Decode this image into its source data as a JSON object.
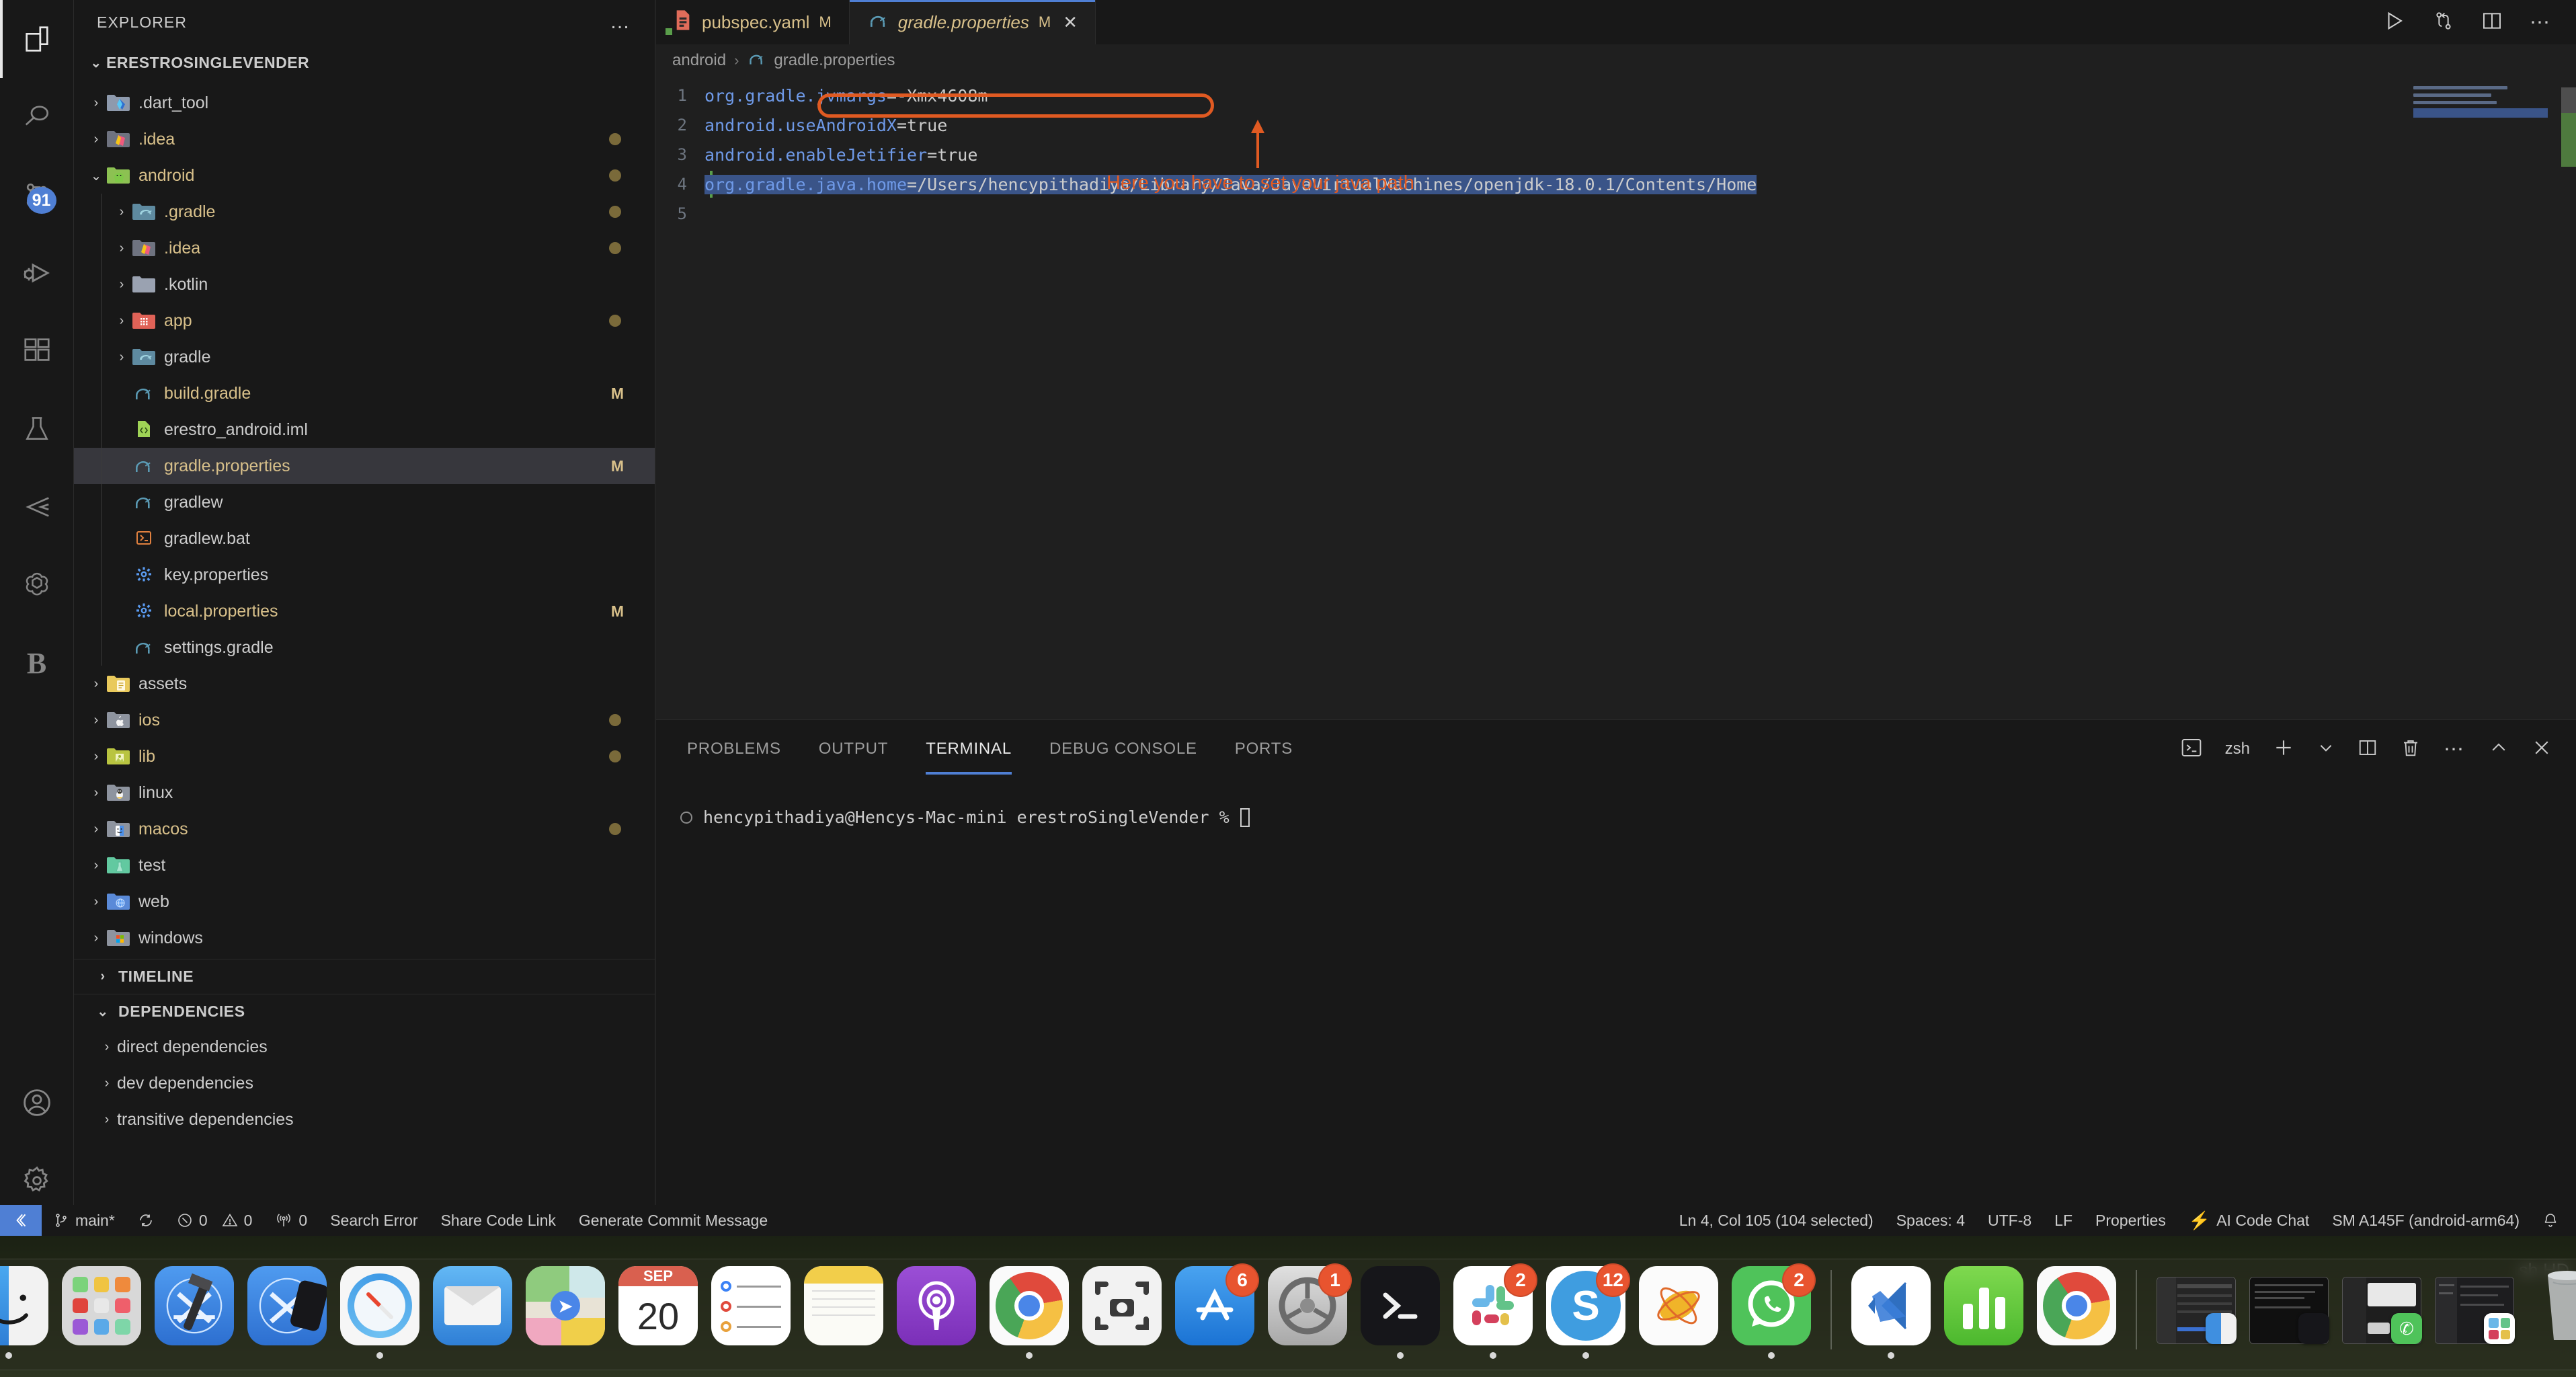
{
  "activity_bar": {
    "items": [
      {
        "name": "explorer",
        "icon": "files-icon",
        "active": true,
        "badge": null
      },
      {
        "name": "search",
        "icon": "search-icon",
        "active": false,
        "badge": null
      },
      {
        "name": "source-control",
        "icon": "source-control-icon",
        "active": false,
        "badge": "91"
      },
      {
        "name": "run-and-debug",
        "icon": "run-debug-icon",
        "active": false,
        "badge": null
      },
      {
        "name": "extensions",
        "icon": "extensions-icon",
        "active": false,
        "badge": null
      },
      {
        "name": "testing",
        "icon": "beaker-icon",
        "active": false,
        "badge": null
      },
      {
        "name": "flutter",
        "icon": "flutter-icon",
        "active": false,
        "badge": null
      },
      {
        "name": "openai",
        "icon": "openai-icon",
        "active": false,
        "badge": null
      },
      {
        "name": "blackbox",
        "icon": "letter-b-icon",
        "active": false,
        "badge": null
      }
    ],
    "bottom_items": [
      {
        "name": "accounts",
        "icon": "account-icon"
      },
      {
        "name": "settings",
        "icon": "gear-icon"
      }
    ]
  },
  "sidebar": {
    "title": "EXPLORER",
    "more_actions": "…",
    "root": "ERESTROSINGLEVENDER",
    "tree": [
      {
        "label": ".dart_tool",
        "type": "folder",
        "depth": 1,
        "expanded": false,
        "icon": "dart-folder-icon",
        "status": "",
        "dot": false
      },
      {
        "label": ".idea",
        "type": "folder",
        "depth": 1,
        "expanded": false,
        "icon": "idea-folder-icon",
        "status": "",
        "dot": true,
        "modified": true
      },
      {
        "label": "android",
        "type": "folder",
        "depth": 1,
        "expanded": true,
        "icon": "android-folder-icon",
        "status": "",
        "dot": true,
        "modified": true
      },
      {
        "label": ".gradle",
        "type": "folder",
        "depth": 2,
        "expanded": false,
        "icon": "gradle-folder-icon",
        "status": "",
        "dot": true,
        "modified": true
      },
      {
        "label": ".idea",
        "type": "folder",
        "depth": 2,
        "expanded": false,
        "icon": "idea-folder-icon",
        "status": "",
        "dot": true,
        "modified": true
      },
      {
        "label": ".kotlin",
        "type": "folder",
        "depth": 2,
        "expanded": false,
        "icon": "plain-folder-icon",
        "status": "",
        "dot": false
      },
      {
        "label": "app",
        "type": "folder",
        "depth": 2,
        "expanded": false,
        "icon": "app-folder-icon",
        "status": "",
        "dot": true,
        "modified": true
      },
      {
        "label": "gradle",
        "type": "folder",
        "depth": 2,
        "expanded": false,
        "icon": "gradle-folder-icon",
        "status": "",
        "dot": false
      },
      {
        "label": "build.gradle",
        "type": "file",
        "depth": 2,
        "icon": "gradle-file-icon",
        "status": "M",
        "modified": true
      },
      {
        "label": "erestro_android.iml",
        "type": "file",
        "depth": 2,
        "icon": "iml-file-icon",
        "status": "",
        "modified": false
      },
      {
        "label": "gradle.properties",
        "type": "file",
        "depth": 2,
        "icon": "gradle-file-icon",
        "status": "M",
        "modified": true,
        "selected": true
      },
      {
        "label": "gradlew",
        "type": "file",
        "depth": 2,
        "icon": "gradle-file-icon",
        "status": "",
        "modified": false
      },
      {
        "label": "gradlew.bat",
        "type": "file",
        "depth": 2,
        "icon": "bat-file-icon",
        "status": "",
        "modified": false
      },
      {
        "label": "key.properties",
        "type": "file",
        "depth": 2,
        "icon": "properties-file-icon",
        "status": "",
        "modified": false
      },
      {
        "label": "local.properties",
        "type": "file",
        "depth": 2,
        "icon": "properties-file-icon",
        "status": "M",
        "modified": true
      },
      {
        "label": "settings.gradle",
        "type": "file",
        "depth": 2,
        "icon": "gradle-file-icon",
        "status": "",
        "modified": false
      },
      {
        "label": "assets",
        "type": "folder",
        "depth": 1,
        "expanded": false,
        "icon": "assets-folder-icon",
        "status": "",
        "dot": false
      },
      {
        "label": "ios",
        "type": "folder",
        "depth": 1,
        "expanded": false,
        "icon": "ios-folder-icon",
        "status": "",
        "dot": true,
        "modified": true
      },
      {
        "label": "lib",
        "type": "folder",
        "depth": 1,
        "expanded": false,
        "icon": "lib-folder-icon",
        "status": "",
        "dot": true,
        "modified": true
      },
      {
        "label": "linux",
        "type": "folder",
        "depth": 1,
        "expanded": false,
        "icon": "linux-folder-icon",
        "status": "",
        "dot": false
      },
      {
        "label": "macos",
        "type": "folder",
        "depth": 1,
        "expanded": false,
        "icon": "macos-folder-icon",
        "status": "",
        "dot": true,
        "modified": true
      },
      {
        "label": "test",
        "type": "folder",
        "depth": 1,
        "expanded": false,
        "icon": "test-folder-icon",
        "status": "",
        "dot": false
      },
      {
        "label": "web",
        "type": "folder",
        "depth": 1,
        "expanded": false,
        "icon": "web-folder-icon",
        "status": "",
        "dot": false
      },
      {
        "label": "windows",
        "type": "folder",
        "depth": 1,
        "expanded": false,
        "icon": "windows-folder-icon",
        "status": "",
        "dot": false
      }
    ],
    "sections": [
      {
        "label": "TIMELINE",
        "expanded": false
      },
      {
        "label": "DEPENDENCIES",
        "expanded": true
      }
    ],
    "dependencies": [
      {
        "label": "direct dependencies"
      },
      {
        "label": "dev dependencies"
      },
      {
        "label": "transitive dependencies"
      }
    ]
  },
  "editor": {
    "tabs": [
      {
        "name": "pubspec.yaml",
        "status": "M",
        "active": false,
        "icon": "yaml-file-icon",
        "closable": false
      },
      {
        "name": "gradle.properties",
        "status": "M",
        "active": true,
        "icon": "gradle-file-icon",
        "closable": true
      }
    ],
    "tab_close": "✕",
    "actions": [
      {
        "name": "run-button",
        "icon": "play-icon"
      },
      {
        "name": "compare-changes-button",
        "icon": "source-control-icon"
      },
      {
        "name": "split-editor-button",
        "icon": "split-editor-icon"
      },
      {
        "name": "more-actions-button",
        "icon": "ellipsis-icon"
      }
    ],
    "breadcrumb": [
      "android",
      "gradle.properties"
    ],
    "lines": [
      {
        "num": "1",
        "key": "org.gradle.jvmargs",
        "eq": "=",
        "value": "-Xmx4608m",
        "selected": false
      },
      {
        "num": "2",
        "key": "android.useAndroidX",
        "eq": "=",
        "value": "true",
        "selected": false
      },
      {
        "num": "3",
        "key": "android.enableJetifier",
        "eq": "=",
        "value": "true",
        "selected": false
      },
      {
        "num": "4",
        "key": "org.gradle.java.home",
        "eq": "=",
        "value": "/Users/hencypithadiya/Library/Java/JavaVirtualMachines/openjdk-18.0.1/Contents/Home",
        "selected": true
      },
      {
        "num": "5",
        "key": "",
        "eq": "",
        "value": "",
        "selected": false
      }
    ],
    "annotation": {
      "text": "Here you have to set your java path",
      "color": "#e05a22"
    }
  },
  "panel": {
    "tabs": [
      {
        "label": "PROBLEMS",
        "active": false
      },
      {
        "label": "OUTPUT",
        "active": false
      },
      {
        "label": "TERMINAL",
        "active": true
      },
      {
        "label": "DEBUG CONSOLE",
        "active": false
      },
      {
        "label": "PORTS",
        "active": false
      }
    ],
    "shell": "zsh",
    "actions": [
      {
        "name": "new-terminal-button",
        "icon": "plus-icon"
      },
      {
        "name": "terminal-profile-dropdown",
        "icon": "chevron-down-icon"
      },
      {
        "name": "split-terminal-button",
        "icon": "split-editor-icon"
      },
      {
        "name": "kill-terminal-button",
        "icon": "trash-icon"
      },
      {
        "name": "panel-more-actions-button",
        "icon": "ellipsis-icon"
      },
      {
        "name": "maximize-panel-button",
        "icon": "chevron-up-icon"
      },
      {
        "name": "close-panel-button",
        "icon": "close-icon"
      }
    ],
    "terminal_prompt": "hencypithadiya@Hencys-Mac-mini erestroSingleVender %"
  },
  "status_bar": {
    "left": [
      {
        "name": "remote-indicator",
        "label": "",
        "icon": "remote-icon"
      },
      {
        "name": "branch",
        "label": "main*",
        "icon": "branch-icon"
      },
      {
        "name": "sync-changes",
        "label": "",
        "icon": "sync-icon"
      },
      {
        "name": "errors",
        "label": "0",
        "icon": "error-icon"
      },
      {
        "name": "warnings",
        "label": "0",
        "icon": "warning-icon"
      },
      {
        "name": "ports-forwarded",
        "label": "0",
        "icon": "radio-tower-icon"
      },
      {
        "name": "search-error",
        "label": "Search Error",
        "icon": ""
      },
      {
        "name": "share-code-link",
        "label": "Share Code Link",
        "icon": ""
      },
      {
        "name": "generate-commit-message",
        "label": "Generate Commit Message",
        "icon": ""
      }
    ],
    "right": [
      {
        "name": "cursor-position",
        "label": "Ln 4, Col 105 (104 selected)",
        "icon": ""
      },
      {
        "name": "indentation",
        "label": "Spaces: 4",
        "icon": ""
      },
      {
        "name": "encoding",
        "label": "UTF-8",
        "icon": ""
      },
      {
        "name": "eol",
        "label": "LF",
        "icon": ""
      },
      {
        "name": "language-mode",
        "label": "Properties",
        "icon": ""
      },
      {
        "name": "ai-code-chat",
        "label": "AI Code Chat",
        "icon": "bolt-icon"
      },
      {
        "name": "device-selector",
        "label": "SM A145F (android-arm64)",
        "icon": ""
      },
      {
        "name": "notifications",
        "label": "",
        "icon": "bell-icon"
      }
    ]
  },
  "dock": {
    "items": [
      {
        "name": "finder",
        "label": "Finder",
        "badge": null,
        "running": true
      },
      {
        "name": "launchpad",
        "label": "Launchpad",
        "badge": null,
        "running": false
      },
      {
        "name": "xcode",
        "label": "Xcode",
        "badge": null,
        "running": false
      },
      {
        "name": "xcode-simulator",
        "label": "Simulator",
        "badge": null,
        "running": false
      },
      {
        "name": "safari",
        "label": "Safari",
        "badge": null,
        "running": true
      },
      {
        "name": "mail",
        "label": "Mail",
        "badge": null,
        "running": false
      },
      {
        "name": "maps",
        "label": "Maps",
        "badge": null,
        "running": false
      },
      {
        "name": "calendar",
        "label": "SEP",
        "day": "20",
        "badge": null,
        "running": false
      },
      {
        "name": "reminders",
        "label": "Reminders",
        "badge": null,
        "running": false
      },
      {
        "name": "notes",
        "label": "Notes",
        "badge": null,
        "running": false
      },
      {
        "name": "podcasts",
        "label": "Podcasts",
        "badge": null,
        "running": false
      },
      {
        "name": "chrome",
        "label": "Chrome",
        "badge": null,
        "running": true
      },
      {
        "name": "screenshot",
        "label": "Screenshot",
        "badge": null,
        "running": false
      },
      {
        "name": "app-store",
        "label": "App Store",
        "badge": "6",
        "running": false
      },
      {
        "name": "system-settings",
        "label": "System Settings",
        "badge": "1",
        "running": false
      },
      {
        "name": "terminal",
        "label": "Terminal",
        "badge": null,
        "running": true
      },
      {
        "name": "slack",
        "label": "Slack",
        "badge": "2",
        "running": true
      },
      {
        "name": "skype",
        "label": "Skype",
        "badge": "12",
        "running": true
      },
      {
        "name": "postman",
        "label": "Postman",
        "badge": null,
        "running": false
      },
      {
        "name": "whatsapp",
        "label": "WhatsApp",
        "badge": "2",
        "running": true
      },
      {
        "name": "vscode",
        "label": "Visual Studio Code",
        "badge": null,
        "running": true
      },
      {
        "name": "numbers",
        "label": "Numbers",
        "badge": null,
        "running": false
      },
      {
        "name": "chrome-2",
        "label": "Chrome",
        "badge": null,
        "running": false
      }
    ],
    "minimized": [
      {
        "name": "minimized-finder-window",
        "overlay": "finder"
      },
      {
        "name": "minimized-terminal-window",
        "overlay": "terminal"
      },
      {
        "name": "minimized-whatsapp-window",
        "overlay": "whatsapp"
      },
      {
        "name": "minimized-slack-window",
        "overlay": "slack"
      }
    ],
    "trash": {
      "name": "trash",
      "label": "Trash"
    }
  },
  "desktop": {
    "volume_label": "sh HD"
  }
}
